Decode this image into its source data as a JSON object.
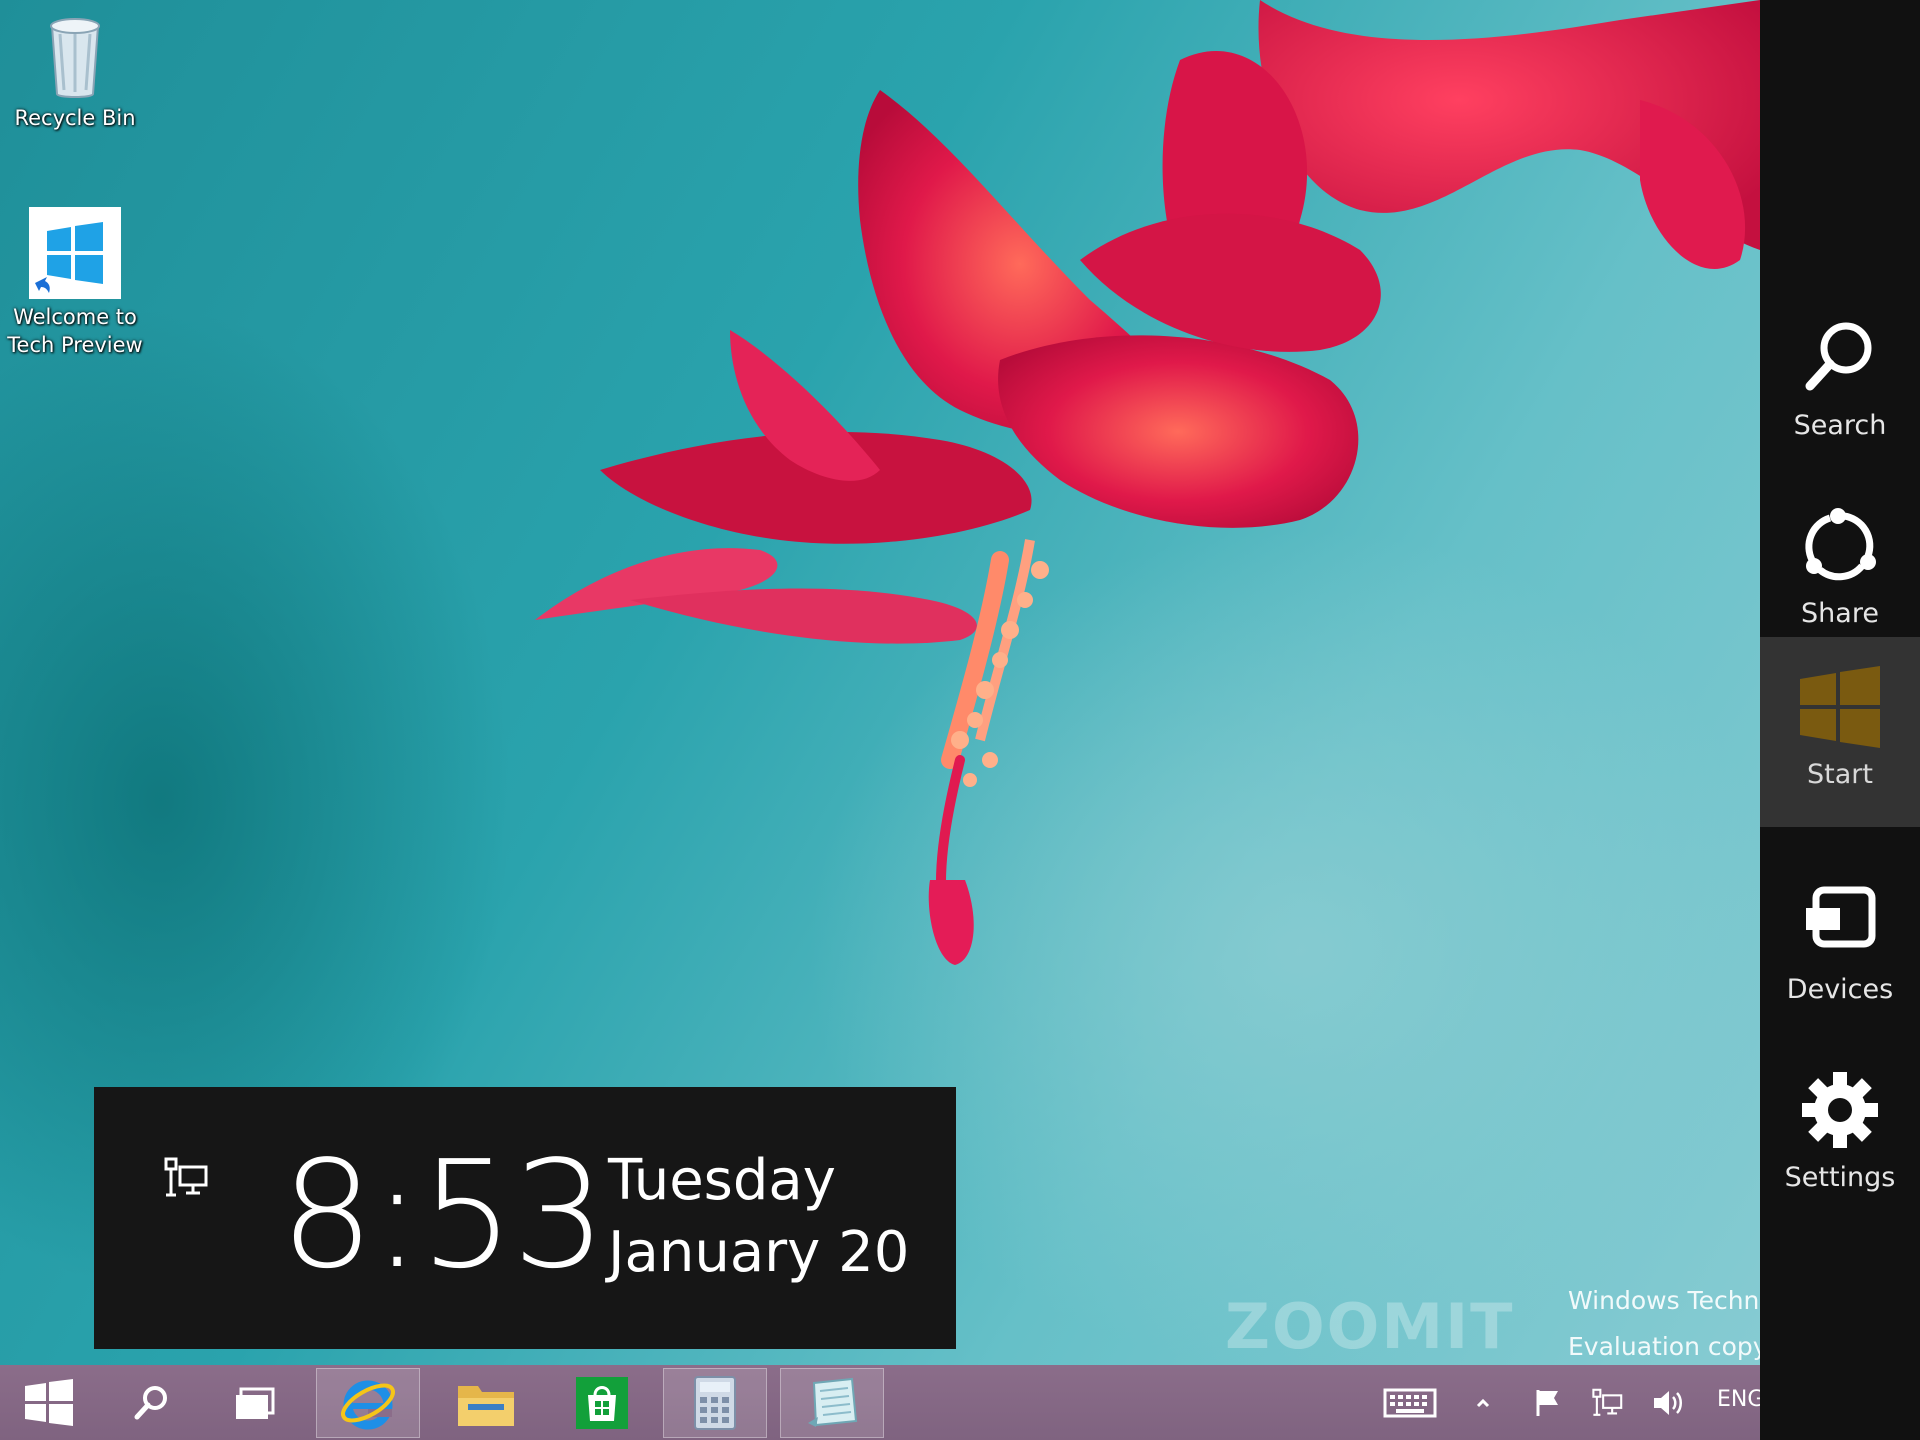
{
  "desktop": {
    "icons": [
      {
        "label": "Recycle Bin",
        "icon": "recycle-bin-icon"
      },
      {
        "label_line1": "Welcome to",
        "label_line2": "Tech Preview",
        "icon": "windows-logo-icon"
      }
    ]
  },
  "watermark": {
    "brand": "ZOOMIT",
    "line1": "Windows Techn",
    "line2": "Evaluation copy"
  },
  "clock": {
    "time": "8:53",
    "day": "Tuesday",
    "date": "January 20",
    "network_icon": "network-icon"
  },
  "charms": {
    "items": [
      {
        "label": "Search",
        "icon": "search-icon"
      },
      {
        "label": "Share",
        "icon": "share-icon"
      },
      {
        "label": "Start",
        "icon": "windows-logo-icon",
        "active": true
      },
      {
        "label": "Devices",
        "icon": "devices-icon"
      },
      {
        "label": "Settings",
        "icon": "gear-icon"
      }
    ]
  },
  "taskbar": {
    "pinned": [
      "start-button",
      "search-button",
      "task-view-button",
      "internet-explorer",
      "file-explorer",
      "store",
      "calculator",
      "notepad"
    ],
    "tray": {
      "language": "ENG",
      "icons": [
        "keyboard-icon",
        "show-hidden-icons-chevron",
        "action-center-flag-icon",
        "network-icon",
        "volume-icon"
      ]
    }
  },
  "colors": {
    "charm_bar": "#111111",
    "charm_active": "#333333",
    "start_logo": "#7a5a10",
    "taskbar": "#8b6d8a",
    "clock_panel": "#161616"
  }
}
